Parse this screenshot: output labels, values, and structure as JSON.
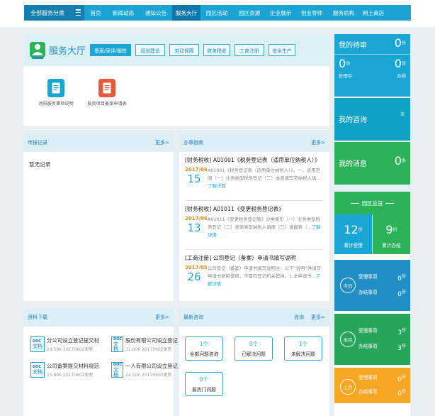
{
  "nav": {
    "category_label": "全部服务分类",
    "items": [
      "首页",
      "新闻动态",
      "通知公告",
      "服务大厅",
      "园区活动",
      "园区资源",
      "企业展示",
      "创业导师",
      "服务机构",
      "网上商店"
    ],
    "active_index": 3
  },
  "hall": {
    "title": "服务大厅",
    "tabs": [
      "备案/采评/跟踪",
      "规划建设",
      "劳动保障",
      "财务税收",
      "工商注册",
      "安全生产"
    ],
    "active_tab": 0,
    "services": [
      {
        "label": "消防服务事项说明",
        "icon": "document-icon",
        "color": "#1aa6d5"
      },
      {
        "label": "投资项目备案申请表",
        "icon": "form-icon",
        "color": "#e55a3a"
      }
    ]
  },
  "application_log": {
    "title": "申报记录",
    "more": "更多>",
    "empty": "暂无记录"
  },
  "guide": {
    "title": "办事指南",
    "more": "更多>",
    "items": [
      {
        "title": "[财务税收] A01001《税务登记表（适用单位纳税人）》",
        "ym": "2017/06",
        "day": "15",
        "text": "A01001《税务登记表（适用单位纳税人）》，一、适用范围（一）业务类型税务登记（二）本表填写范纳税人填...",
        "more_link": "了解详情"
      },
      {
        "title": "[财务税收] A01011《变更税务登记表》",
        "ym": "2017/06",
        "day": "13",
        "text": "A01011《变更税务登记表》分类索引（一）业务类型税务登记（二）表单类型纳税人填报（三）填报表（...",
        "more_link": "了解详情"
      },
      {
        "title": "[工商注册] 公司登记（备案）申请书填写说明",
        "ym": "2017/05",
        "day": "26",
        "text": "公司登记（备案）申请书填写说明注：以下“说明”供填写申请书参照使用，不需向登记机关提供。1.本申请书...",
        "more_link": "了解详情"
      }
    ]
  },
  "downloads": {
    "title": "资料下载",
    "more": "更多>",
    "doc_tag": "DOC",
    "doc_word": "文档",
    "items": [
      {
        "name": "分公司设立登记提交材",
        "size": "29.50K",
        "date": "20170602更新"
      },
      {
        "name": "股份有限公司设立登记",
        "size": "31.00K",
        "date": "20170602更新"
      },
      {
        "name": "公司备案提交材料规范",
        "size": "15.89K",
        "date": "20170602更新"
      },
      {
        "name": "一人有限公司设立登记",
        "size": "24.50K",
        "date": "20170602更新"
      }
    ]
  },
  "consult": {
    "title": "最新咨询",
    "ask": "咨询",
    "more": "更多>",
    "buttons": [
      {
        "num": "1个",
        "label": "全部问题咨询"
      },
      {
        "num": "0个",
        "label": "已解决问题"
      },
      {
        "num": "1个",
        "label": "未解决问题"
      },
      {
        "num": "0个",
        "label": "最热门问题"
      }
    ]
  },
  "right": {
    "todo": {
      "title": "我的待审",
      "count": "0",
      "sup": "份",
      "processing_num": "0",
      "processing_label": "处理中",
      "done_num": "0",
      "done_label": "办结"
    },
    "consult": {
      "title": "我的咨询",
      "sup": "次"
    },
    "messages": {
      "title": "我的消息",
      "count": "0",
      "sup": "条"
    },
    "park": {
      "title": "园区总览",
      "accepted_num": "12",
      "accepted_label": "累计受理",
      "done_num": "9",
      "done_label": "累计办结",
      "sup": "份",
      "periods": [
        {
          "label": "今日",
          "accepted_label": "受理事项",
          "accepted": "0",
          "done_label": "办结事项",
          "done": "0"
        },
        {
          "label": "本月",
          "accepted_label": "受理事项",
          "accepted": "3",
          "done_label": "办结事项",
          "done": "3"
        },
        {
          "label": "上月",
          "accepted_label": "受理事项",
          "accepted": "0",
          "done_label": "办结事项",
          "done": "0"
        }
      ],
      "period_sup": "份"
    }
  },
  "colors": {
    "nav": "#19a4d4",
    "todo": "#1aa6d5",
    "consult": "#0fa2c4",
    "messages": "#2cb35a",
    "today": "#1f8fc6",
    "month": "#27a65b",
    "last_month": "#f5a623"
  }
}
